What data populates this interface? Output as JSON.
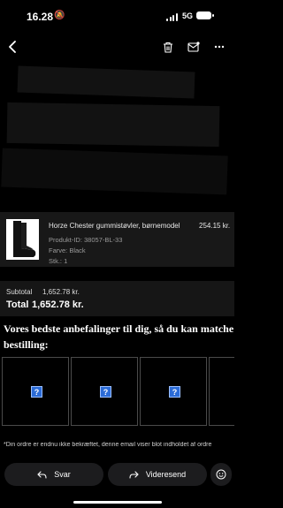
{
  "status_bar": {
    "time": "16.28",
    "network": "5G"
  },
  "product": {
    "name": "Horze Chester gummistøvler, børnemodel",
    "price": "254.15 kr.",
    "id_line": "Produkt-ID: 38057-BL-33",
    "color_line": "Farve: Black",
    "qty_line": "Stk.: 1"
  },
  "totals": {
    "subtotal_label": "Subtotal",
    "subtotal_value": "1,652.78 kr.",
    "total_label": "Total",
    "total_value": "1,652.78 kr."
  },
  "recommendations": {
    "heading_line1": "Vores bedste anbefalinger til dig, så du kan matche",
    "heading_line2": "bestilling:",
    "placeholder_glyph": "?"
  },
  "footer_note": "*Din ordre er endnu ikke bekræftet, denne email viser blot indholdet af ordre",
  "actions": {
    "reply": "Svar",
    "forward": "Videresend"
  },
  "icons": [
    "back-icon",
    "trash-icon",
    "mail-icon",
    "more-icon",
    "reply-icon",
    "forward-icon",
    "emoji-icon"
  ],
  "colors": {
    "background": "#000000",
    "accent_placeholder": "#2b6bd6"
  }
}
